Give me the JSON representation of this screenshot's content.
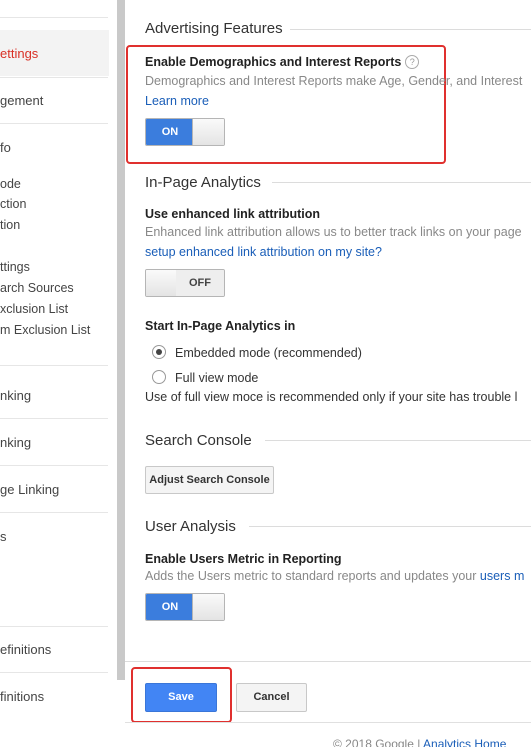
{
  "sidebar": {
    "items": [
      {
        "label": "ettings"
      },
      {
        "label": "gement"
      },
      {
        "label": "fo"
      },
      {
        "label": "ode"
      },
      {
        "label": "ction"
      },
      {
        "label": "tion"
      },
      {
        "label": "ttings"
      },
      {
        "label": "arch Sources"
      },
      {
        "label": "xclusion List"
      },
      {
        "label": "m Exclusion List"
      },
      {
        "label": "nking"
      },
      {
        "label": "nking"
      },
      {
        "label": "ge Linking"
      },
      {
        "label": "s"
      },
      {
        "label": "efinitions"
      },
      {
        "label": "finitions"
      }
    ],
    "active_color": "#d93025"
  },
  "advertising": {
    "title": "Advertising Features",
    "label": "Enable Demographics and Interest Reports",
    "help": "?",
    "desc": "Demographics and Interest Reports make Age, Gender, and Interest",
    "learn_more": "Learn more",
    "toggle": "ON"
  },
  "inpage": {
    "title": "In-Page Analytics",
    "label": "Use enhanced link attribution",
    "desc": "Enhanced link attribution allows us to better track links on your page",
    "link": "setup enhanced link attribution on my site?",
    "toggle": "OFF",
    "start_label": "Start In-Page Analytics in",
    "option_embedded": "Embedded mode (recommended)",
    "option_full": "Full view mode",
    "note": "Use of full view moce is recommended only if your site has trouble l"
  },
  "search_console": {
    "title": "Search Console",
    "button": "Adjust Search Console"
  },
  "user_analysis": {
    "title": "User Analysis",
    "label": "Enable Users Metric in Reporting",
    "desc": "Adds the Users metric to standard reports and updates your",
    "desc_link": "users m",
    "toggle": "ON"
  },
  "actions": {
    "save": "Save",
    "cancel": "Cancel"
  },
  "footer": {
    "copyright": "© 2018 Google |",
    "link": "Analytics Home"
  },
  "colors": {
    "accent": "#4285f4",
    "toggle_on": "#3b7ddd",
    "link": "#1a5eb8",
    "highlight": "#e0302e"
  }
}
